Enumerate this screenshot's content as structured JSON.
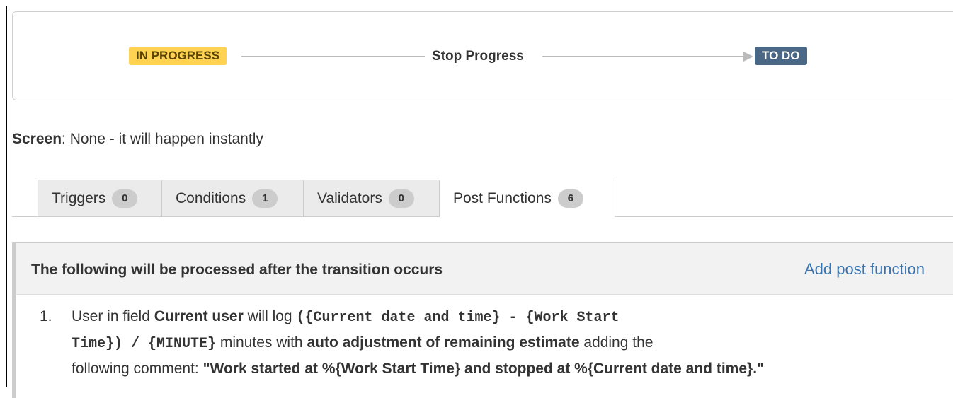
{
  "workflow": {
    "from_status": "IN PROGRESS",
    "transition_name": "Stop Progress",
    "to_status": "TO DO",
    "colors": {
      "in_progress_bg": "#ffd351",
      "todo_bg": "#4a6785"
    }
  },
  "screen": {
    "label": "Screen",
    "value": ": None - it will happen instantly"
  },
  "tabs": [
    {
      "label": "Triggers",
      "count": "0"
    },
    {
      "label": "Conditions",
      "count": "1"
    },
    {
      "label": "Validators",
      "count": "0"
    },
    {
      "label": "Post Functions",
      "count": "6",
      "active": true
    }
  ],
  "post_functions": {
    "header": "The following will be processed after the transition occurs",
    "add_link": "Add post function",
    "items": [
      {
        "number": "1.",
        "parts": {
          "p1": "User in field ",
          "field": "Current user",
          "p2": " will log ",
          "expr1": "({Current date and time} - {Work Start",
          "expr2": "Time}) / {MINUTE}",
          "p3": " minutes with ",
          "adjust": "auto adjustment of remaining estimate",
          "p4": " adding the",
          "p5": "following comment: ",
          "comment": "\"Work started at %{Work Start Time} and stopped at %{Current date and time}.\""
        }
      }
    ]
  }
}
